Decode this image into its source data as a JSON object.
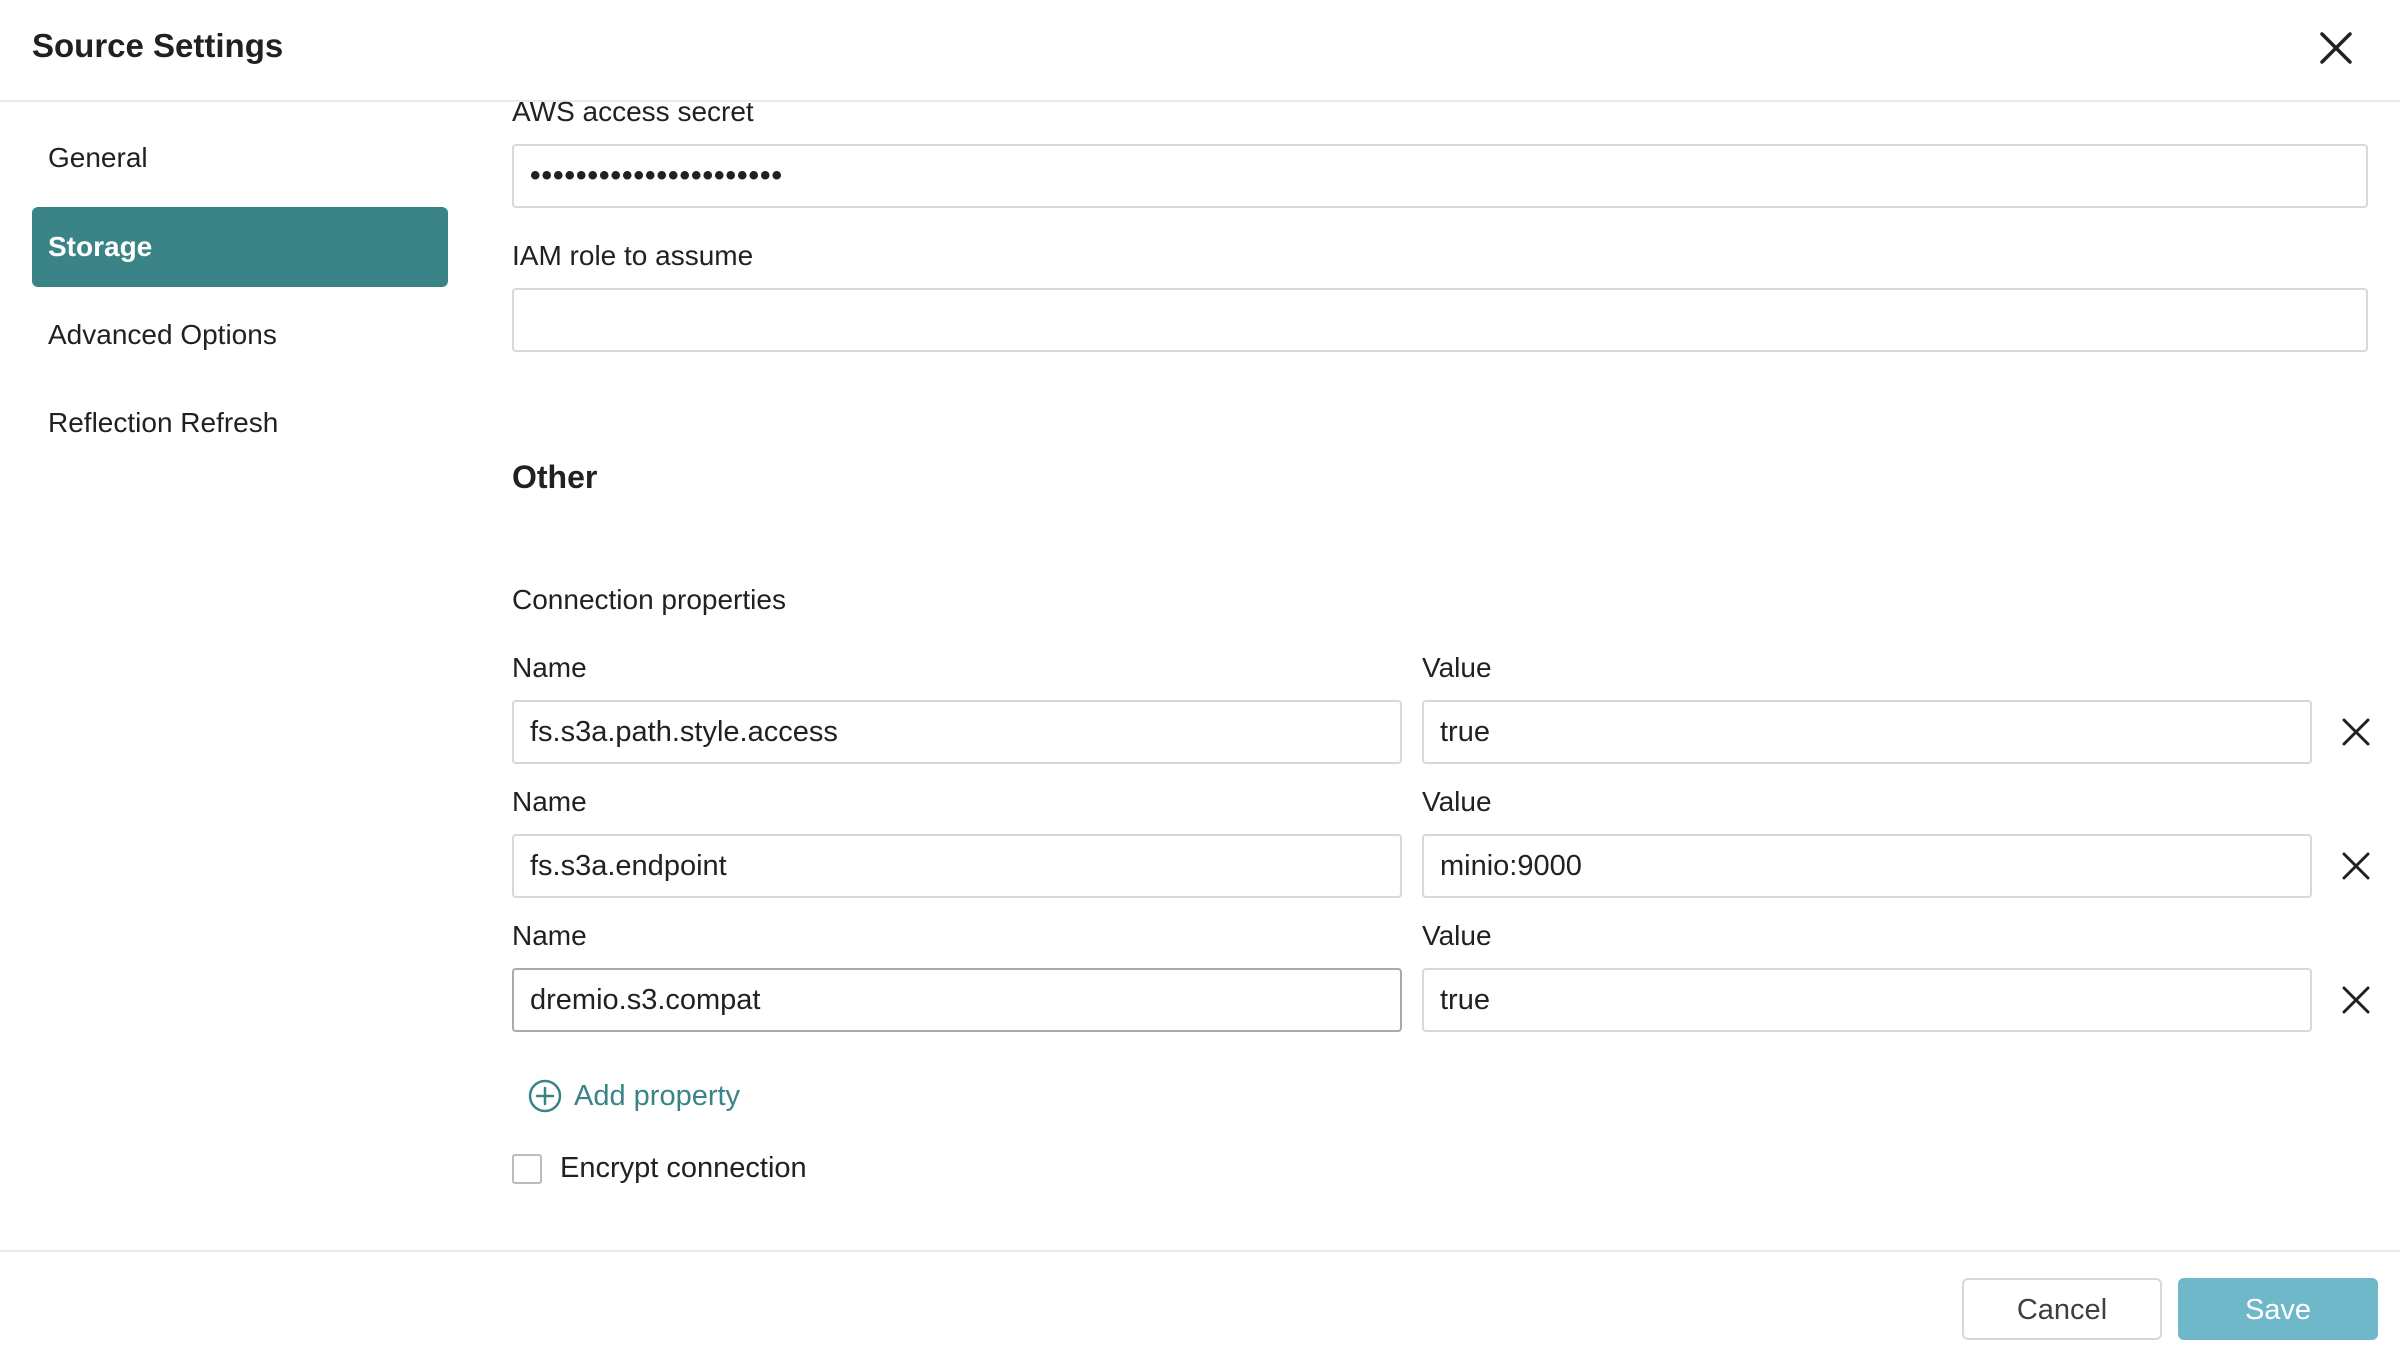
{
  "dialog": {
    "title": "Source Settings",
    "close_icon": "close-icon"
  },
  "sidebar": {
    "items": [
      {
        "label": "General",
        "active": false
      },
      {
        "label": "Storage",
        "active": true
      },
      {
        "label": "Advanced Options",
        "active": false
      },
      {
        "label": "Reflection Refresh",
        "active": false
      }
    ]
  },
  "storage": {
    "aws_secret_label": "AWS access secret",
    "aws_secret_value": "••••••••••••••••••••••",
    "iam_role_label": "IAM role to assume",
    "iam_role_value": ""
  },
  "other": {
    "section_title": "Other",
    "connection_properties_label": "Connection properties",
    "name_label": "Name",
    "value_label": "Value",
    "properties": [
      {
        "name": "fs.s3a.path.style.access",
        "value": "true"
      },
      {
        "name": "fs.s3a.endpoint",
        "value": "minio:9000"
      },
      {
        "name": "dremio.s3.compat",
        "value": "true"
      }
    ],
    "add_property_label": "Add property",
    "encrypt_connection_label": "Encrypt connection",
    "encrypt_connection_checked": false
  },
  "footer": {
    "cancel_label": "Cancel",
    "save_label": "Save"
  },
  "colors": {
    "accent": "#3a8487",
    "save_button": "#6fb8c9"
  }
}
